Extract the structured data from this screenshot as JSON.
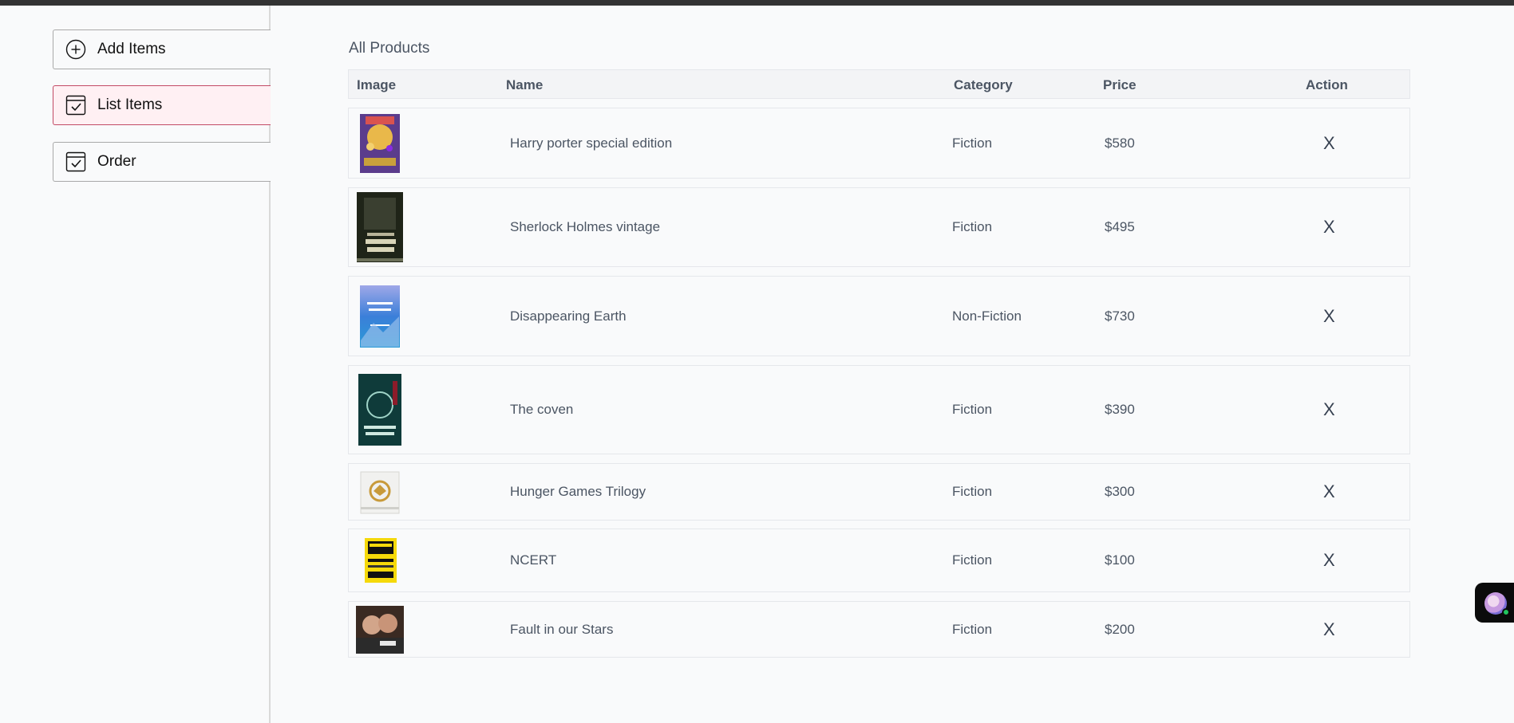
{
  "sidebar": {
    "items": [
      {
        "label": "Add Items",
        "icon": "plus-circle-icon"
      },
      {
        "label": "List Items",
        "icon": "checkbox-icon"
      },
      {
        "label": "Order",
        "icon": "checkbox-icon"
      }
    ]
  },
  "main": {
    "title": "All Products",
    "columns": {
      "image": "Image",
      "name": "Name",
      "category": "Category",
      "price": "Price",
      "action": "Action"
    },
    "rows": [
      {
        "name": "Harry porter special edition",
        "category": "Fiction",
        "price": "$580",
        "action": "X"
      },
      {
        "name": "Sherlock Holmes vintage",
        "category": "Fiction",
        "price": "$495",
        "action": "X"
      },
      {
        "name": "Disappearing Earth",
        "category": "Non-Fiction",
        "price": "$730",
        "action": "X"
      },
      {
        "name": "The coven",
        "category": "Fiction",
        "price": "$390",
        "action": "X"
      },
      {
        "name": "Hunger Games Trilogy",
        "category": "Fiction",
        "price": "$300",
        "action": "X"
      },
      {
        "name": "NCERT",
        "category": "Fiction",
        "price": "$100",
        "action": "X"
      },
      {
        "name": "Fault in our Stars",
        "category": "Fiction",
        "price": "$200",
        "action": "X"
      }
    ]
  },
  "colors": {
    "active_bg": "#fff0f3",
    "active_border": "#c24a65",
    "online_dot": "#22c55e"
  }
}
